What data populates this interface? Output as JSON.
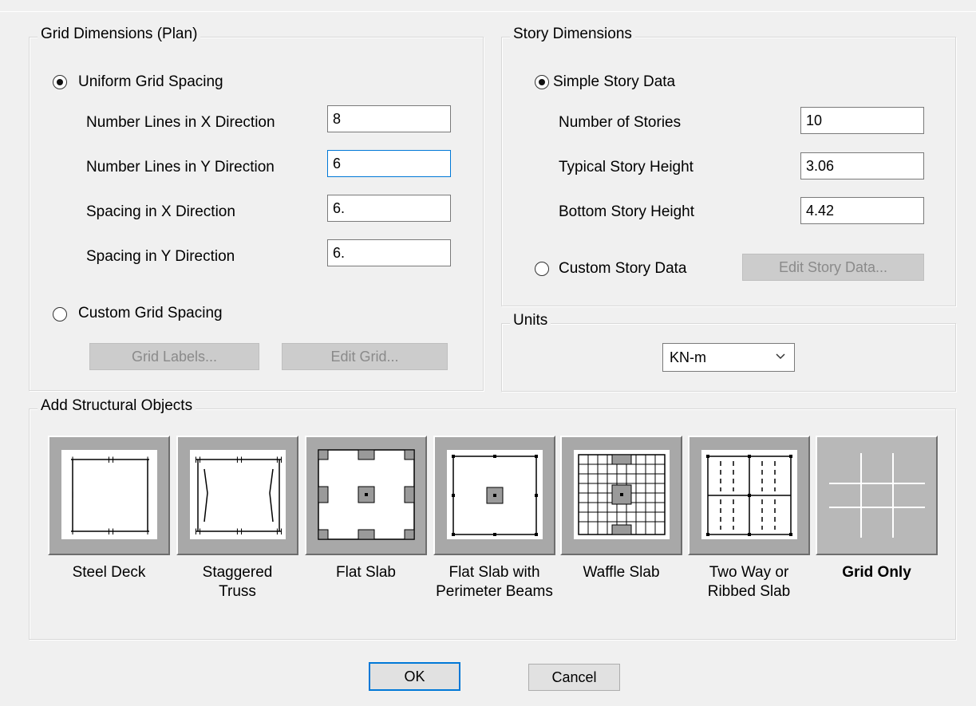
{
  "grid": {
    "legend": "Grid Dimensions (Plan)",
    "uniform_label": "Uniform Grid Spacing",
    "rows": [
      {
        "label": "Number Lines in X Direction",
        "value": "8"
      },
      {
        "label": "Number Lines in Y Direction",
        "value": "6"
      },
      {
        "label": "Spacing in X Direction",
        "value": "6."
      },
      {
        "label": "Spacing in Y Direction",
        "value": "6."
      }
    ],
    "custom_label": "Custom Grid Spacing",
    "grid_labels_button": "Grid Labels...",
    "edit_grid_button": "Edit Grid..."
  },
  "story": {
    "legend": "Story Dimensions",
    "simple_label": "Simple Story Data",
    "rows": [
      {
        "label": "Number of Stories",
        "value": "10"
      },
      {
        "label": "Typical Story Height",
        "value": "3.06"
      },
      {
        "label": "Bottom Story Height",
        "value": "4.42"
      }
    ],
    "custom_label": "Custom Story Data",
    "edit_story_button": "Edit Story Data..."
  },
  "units": {
    "legend": "Units",
    "selected": "KN-m"
  },
  "objects": {
    "legend": "Add Structural Objects",
    "items": [
      {
        "label": "Steel Deck",
        "icon": "steel-deck-icon"
      },
      {
        "label": "Staggered\nTruss",
        "icon": "staggered-truss-icon"
      },
      {
        "label": "Flat Slab",
        "icon": "flat-slab-icon"
      },
      {
        "label": "Flat Slab with\nPerimeter Beams",
        "icon": "flat-slab-perimeter-beams-icon"
      },
      {
        "label": "Waffle Slab",
        "icon": "waffle-slab-icon"
      },
      {
        "label": "Two Way or\nRibbed Slab",
        "icon": "two-way-ribbed-slab-icon"
      },
      {
        "label": "Grid Only",
        "icon": "grid-only-icon"
      }
    ]
  },
  "buttons": {
    "ok": "OK",
    "cancel": "Cancel"
  },
  "colors": {
    "focus_border": "#0078d7",
    "disabled_button": "#cccccc"
  }
}
